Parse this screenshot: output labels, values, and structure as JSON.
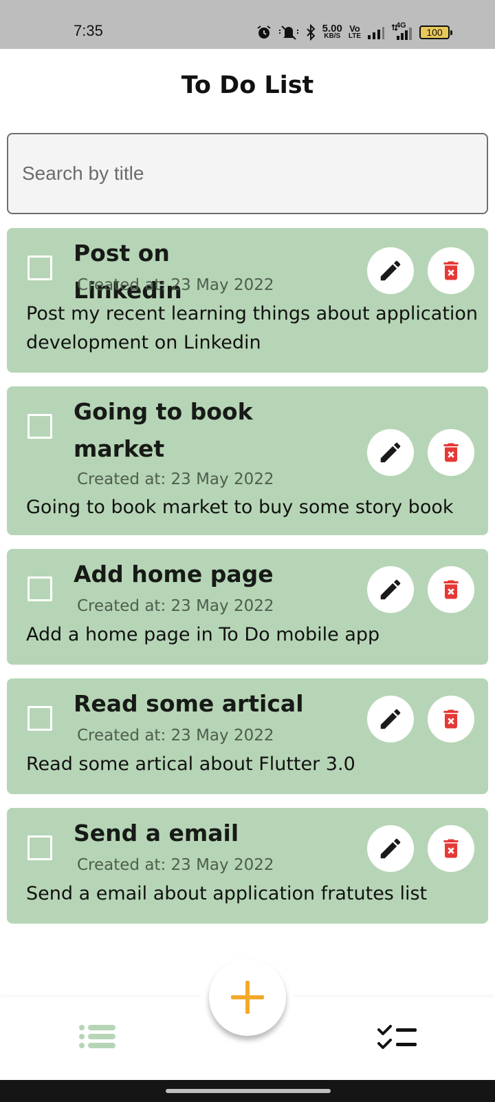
{
  "status_bar": {
    "time": "7:35",
    "net_speed_value": "5.00",
    "net_speed_unit": "KB/S",
    "volte_top": "Vo",
    "volte_bottom": "LTE",
    "network_type": "4G",
    "battery": "100",
    "icons": [
      "alarm-icon",
      "mute-icon",
      "bluetooth-icon",
      "signal-icon",
      "data-arrows-icon",
      "battery-icon"
    ]
  },
  "header": {
    "title": "To Do List"
  },
  "search": {
    "placeholder": "Search by title",
    "value": ""
  },
  "todos": [
    {
      "title": "Post on Linkedin",
      "created": "Created at: 23 May 2022",
      "description": "Post my recent learning things about application development on Linkedin",
      "checked": false
    },
    {
      "title": "Going to book market",
      "created": "Created at: 23 May 2022",
      "description": "Going to book market to buy some story book",
      "checked": false
    },
    {
      "title": "Add home page",
      "created": "Created at: 23 May 2022",
      "description": "Add a home page in To Do mobile app",
      "checked": false
    },
    {
      "title": "Read some artical",
      "created": "Created at: 23 May 2022",
      "description": "Read some artical about Flutter 3.0",
      "checked": false
    },
    {
      "title": "Send a email",
      "created": "Created at: 23 May 2022",
      "description": "Send a email about application fratutes list",
      "checked": false
    }
  ],
  "colors": {
    "card_background": "#b6d5b6",
    "delete_red": "#e53935",
    "fab_accent": "#f3a928",
    "nav_active_green": "#b6d5b6",
    "status_bar": "#bdbdbd"
  },
  "bottom_nav": {
    "items": [
      {
        "icon": "list-icon",
        "active": true
      },
      {
        "icon": "checklist-icon",
        "active": false
      }
    ],
    "fab_icon": "plus-icon"
  }
}
